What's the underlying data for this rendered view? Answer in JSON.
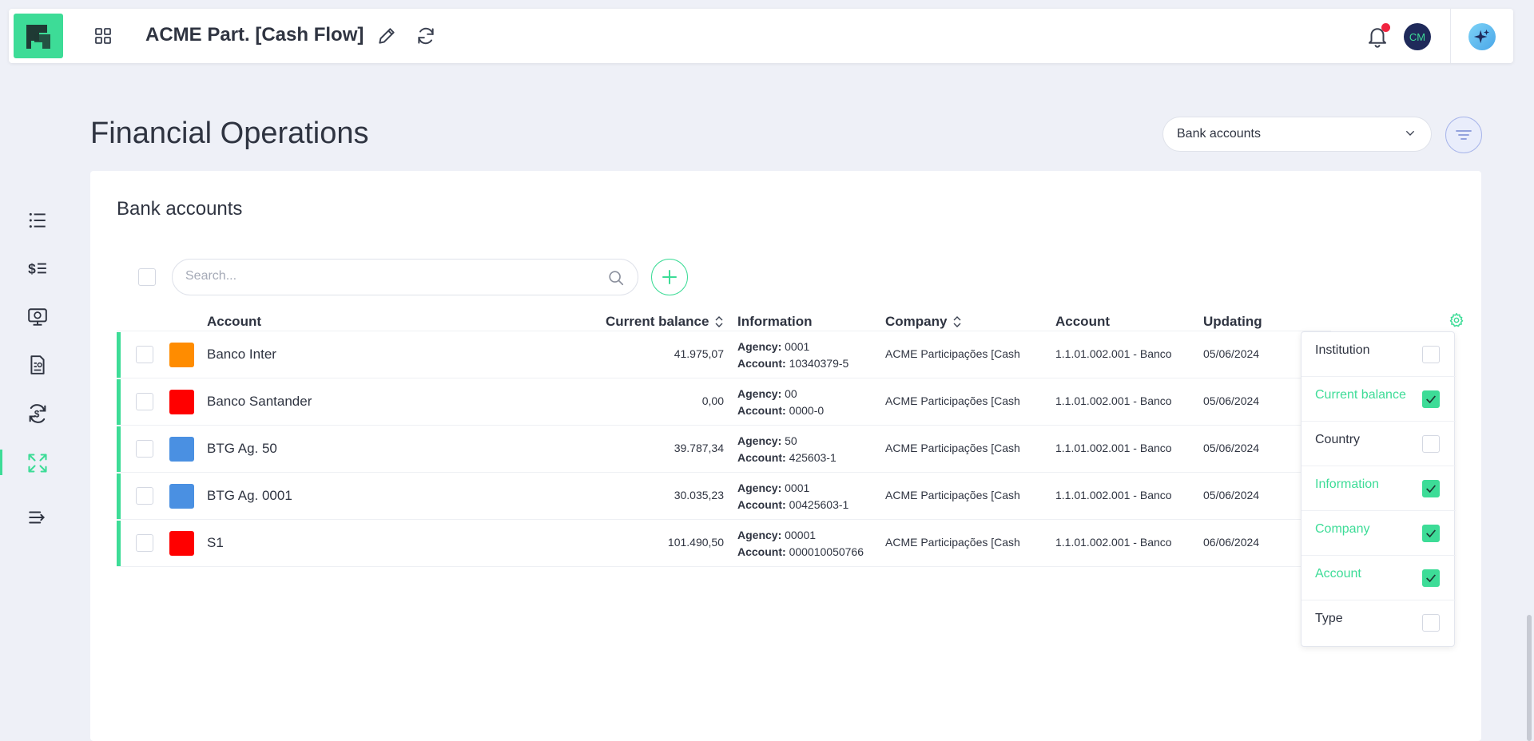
{
  "header": {
    "app_title": "ACME Part. [Cash Flow]",
    "avatar_initials": "CM",
    "notification_indicator": true
  },
  "page": {
    "title": "Financial Operations",
    "view_select": "Bank accounts"
  },
  "card": {
    "title": "Bank accounts",
    "search_placeholder": "Search..."
  },
  "table": {
    "columns": [
      {
        "label": "Account",
        "sortable": false
      },
      {
        "label": "Current balance",
        "sortable": true
      },
      {
        "label": "Information",
        "sortable": false
      },
      {
        "label": "Company",
        "sortable": true
      },
      {
        "label": "Account",
        "sortable": false
      },
      {
        "label": "Updating",
        "sortable": false
      }
    ],
    "agency_label": "Agency:",
    "account_label": "Account:",
    "rows": [
      {
        "name": "Banco Inter",
        "color": "#ff8c00",
        "balance": "41.975,07",
        "agency": "0001",
        "account": "10340379-5",
        "company": "ACME Participações [Cash",
        "ledger": "1.1.01.002.001 - Banco",
        "updated": "05/06/2024"
      },
      {
        "name": "Banco Santander",
        "color": "#ff0000",
        "balance": "0,00",
        "agency": "00",
        "account": "0000-0",
        "company": "ACME Participações [Cash",
        "ledger": "1.1.01.002.001 - Banco",
        "updated": "05/06/2024"
      },
      {
        "name": "BTG Ag. 50",
        "color": "#4a90e2",
        "balance": "39.787,34",
        "agency": "50",
        "account": "425603-1",
        "company": "ACME Participações [Cash",
        "ledger": "1.1.01.002.001 - Banco",
        "updated": "05/06/2024"
      },
      {
        "name": "BTG Ag. 0001",
        "color": "#4a90e2",
        "balance": "30.035,23",
        "agency": "0001",
        "account": "00425603-1",
        "company": "ACME Participações [Cash",
        "ledger": "1.1.01.002.001 - Banco",
        "updated": "05/06/2024"
      },
      {
        "name": "S1",
        "color": "#ff0000",
        "balance": "101.490,50",
        "agency": "00001",
        "account": "000010050766",
        "company": "ACME Participações [Cash",
        "ledger": "1.1.01.002.001 - Banco",
        "updated": "06/06/2024"
      }
    ]
  },
  "column_picker": [
    {
      "label": "Institution",
      "checked": false
    },
    {
      "label": "Current balance",
      "checked": true
    },
    {
      "label": "Country",
      "checked": false
    },
    {
      "label": "Information",
      "checked": true
    },
    {
      "label": "Company",
      "checked": true
    },
    {
      "label": "Account",
      "checked": true
    },
    {
      "label": "Type",
      "checked": false
    }
  ],
  "sidebar": {
    "items": [
      {
        "icon": "list-icon"
      },
      {
        "icon": "dollar-list-icon"
      },
      {
        "icon": "monitor-dollar-icon"
      },
      {
        "icon": "report-document-icon"
      },
      {
        "icon": "exchange-dollar-icon"
      },
      {
        "icon": "expand-arrows-icon",
        "active": true
      },
      {
        "icon": "collapse-menu-icon"
      }
    ]
  },
  "colors": {
    "accent": "#3ddc97",
    "text": "#2f3441",
    "background": "#eef0f7"
  }
}
